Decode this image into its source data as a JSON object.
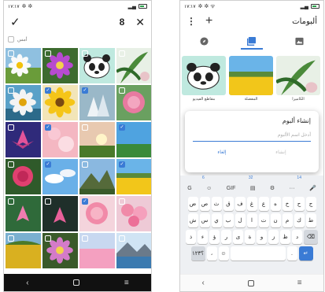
{
  "left": {
    "status": {
      "time": "١٧:١٧"
    },
    "toolbar": {
      "confirm_icon": "check-icon",
      "count": "8",
      "close_icon": "close-icon"
    },
    "date_label": "أمس",
    "photos": [
      {
        "scene": "daisy",
        "selected": false
      },
      {
        "scene": "purple-flower",
        "selected": false
      },
      {
        "scene": "panda",
        "selected": false
      },
      {
        "scene": "green-leaves",
        "selected": false
      },
      {
        "scene": "sunflower",
        "selected": false
      },
      {
        "scene": "yellow-sunflower",
        "selected": true
      },
      {
        "scene": "lilies",
        "selected": true
      },
      {
        "scene": "pink-peony",
        "selected": false
      },
      {
        "scene": "pink-lotus-blue",
        "selected": false
      },
      {
        "scene": "pink-bokeh",
        "selected": true
      },
      {
        "scene": "sunrise",
        "selected": false
      },
      {
        "scene": "grass-sky",
        "selected": true
      },
      {
        "scene": "red-rose",
        "selected": false
      },
      {
        "scene": "blue-sky",
        "selected": true
      },
      {
        "scene": "mountain",
        "selected": false
      },
      {
        "scene": "yellow-field",
        "selected": true
      },
      {
        "scene": "lotus-green",
        "selected": false
      },
      {
        "scene": "lotus-dark",
        "selected": false
      },
      {
        "scene": "rose-pink",
        "selected": true
      },
      {
        "scene": "pink-bouquet",
        "selected": false
      },
      {
        "scene": "yellow-grass",
        "selected": false
      },
      {
        "scene": "orchid",
        "selected": false
      },
      {
        "scene": "pink-field",
        "selected": false
      },
      {
        "scene": "lake",
        "selected": false
      }
    ],
    "nav": {
      "back": "‹",
      "recents": "≡"
    }
  },
  "right": {
    "status": {
      "time": "١٧:١٧"
    },
    "header": {
      "menu_icon": "more-vert-icon",
      "add_icon": "plus-icon",
      "title": "ألبومات"
    },
    "tabs": [
      {
        "name": "tab-explore",
        "icon": "compass-icon",
        "active": false
      },
      {
        "name": "tab-albums",
        "icon": "album-icon",
        "active": true
      },
      {
        "name": "tab-photos",
        "icon": "image-icon",
        "active": false
      }
    ],
    "albums": [
      {
        "label": "الكاميرا",
        "scene": "green-leaves"
      },
      {
        "label": "المفضلة",
        "scene": "yellow-field"
      },
      {
        "label": "مقاطع الفيديو",
        "scene": "panda"
      }
    ],
    "dialog": {
      "title": "إنشاء ألبوم",
      "placeholder": "أدخل اسم الألبوم",
      "cancel": "إلغاء",
      "create": "إنشاء"
    },
    "keyboard": {
      "hints": [
        "6",
        "32",
        "14"
      ],
      "tools": [
        "G",
        "☺",
        "GIF",
        "▤",
        "⚙",
        "···",
        "🎤"
      ],
      "row1": [
        "ج",
        "ح",
        "خ",
        "ه",
        "ع",
        "غ",
        "ف",
        "ق",
        "ث",
        "ص",
        "ض"
      ],
      "row2": [
        "ط",
        "ك",
        "م",
        "ن",
        "ت",
        "ا",
        "ل",
        "ب",
        "ي",
        "س",
        "ش"
      ],
      "row3": [
        "⌫",
        "د",
        "ظ",
        "ز",
        "و",
        "ة",
        "ى",
        "ر",
        "ؤ",
        "ء",
        "ذ"
      ],
      "row4": [
        "↵",
        ".",
        "",
        "☺",
        "،",
        "؟١٢٣"
      ]
    },
    "nav": {
      "back": "‹",
      "recents": "≡"
    }
  }
}
